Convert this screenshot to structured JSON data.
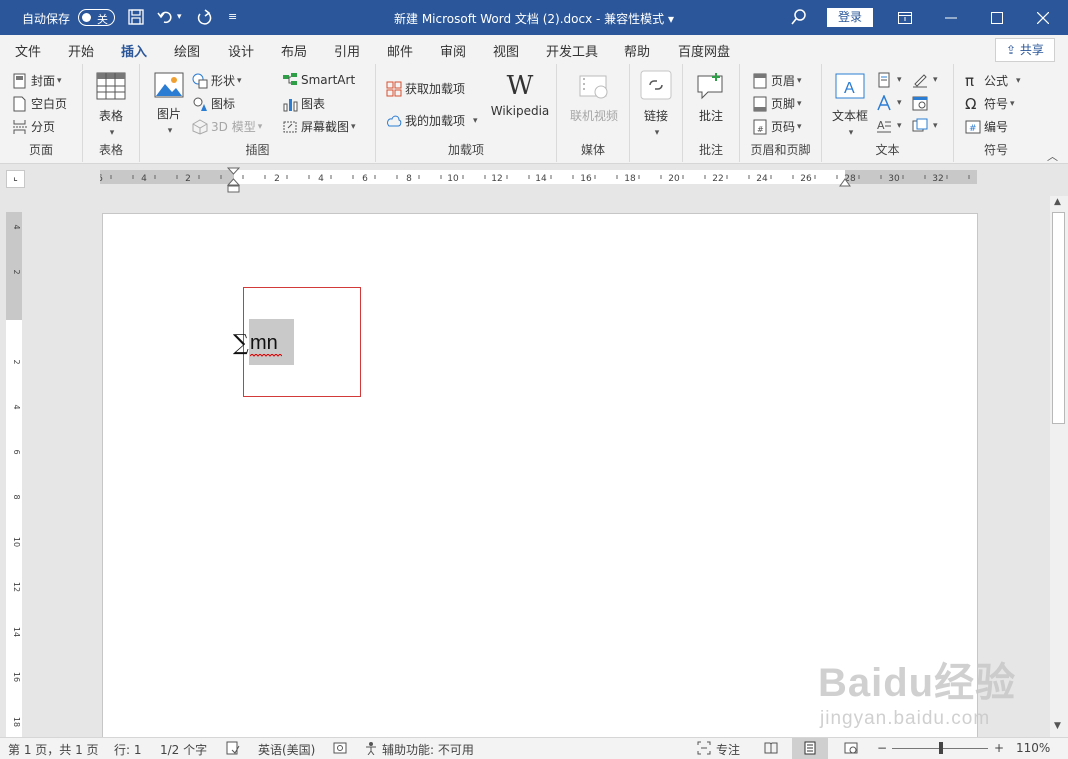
{
  "titlebar": {
    "autosave_label": "自动保存",
    "autosave_state": "关",
    "document_title": "新建 Microsoft Word 文档 (2).docx  -  兼容性模式 ▾",
    "login_label": "登录"
  },
  "tabs": [
    "文件",
    "开始",
    "插入",
    "绘图",
    "设计",
    "布局",
    "引用",
    "邮件",
    "审阅",
    "视图",
    "开发工具",
    "帮助",
    "百度网盘"
  ],
  "active_tab": "插入",
  "share_label": "共享",
  "ribbon": {
    "pages": {
      "label": "页面",
      "cover": "封面",
      "blank": "空白页",
      "break": "分页"
    },
    "table": {
      "label": "表格",
      "table": "表格"
    },
    "illustrations": {
      "label": "插图",
      "picture": "图片",
      "shapes": "形状",
      "icons": "图标",
      "model3d": "3D 模型",
      "smartart": "SmartArt",
      "chart": "图表",
      "screenshot": "屏幕截图"
    },
    "addins": {
      "label": "加载项",
      "get": "获取加载项",
      "mine": "我的加载项",
      "wikipedia": "Wikipedia"
    },
    "media": {
      "label": "媒体",
      "online_video": "联机视频"
    },
    "links": {
      "link": "链接"
    },
    "comments": {
      "label": "批注",
      "comment": "批注"
    },
    "header_footer": {
      "label": "页眉和页脚",
      "header": "页眉",
      "footer": "页脚",
      "page_number": "页码"
    },
    "text": {
      "label": "文本",
      "textbox": "文本框"
    },
    "symbols": {
      "label": "符号",
      "equation": "公式",
      "symbol": "符号",
      "number": "编号"
    }
  },
  "ruler": {
    "h_ticks": [
      "6",
      "4",
      "2",
      "2",
      "4",
      "6",
      "8",
      "10",
      "12",
      "14",
      "16",
      "18",
      "20",
      "22",
      "24",
      "26",
      "28",
      "30",
      "32"
    ],
    "v_ticks": [
      "4",
      "2",
      "2",
      "4",
      "6",
      "8",
      "10",
      "12",
      "14",
      "16",
      "18"
    ]
  },
  "document": {
    "equation_symbol": "∑",
    "equation_text": "mn"
  },
  "statusbar": {
    "page": "第 1 页，共 1 页",
    "line": "行: 1",
    "words": "1/2 个字",
    "language": "英语(美国)",
    "accessibility": "辅助功能: 不可用",
    "focus": "专注",
    "zoom": "110%",
    "zoom_level": 0.5
  },
  "watermark": {
    "line1": "Baidu经验",
    "line2": "jingyan.baidu.com"
  },
  "colors": {
    "brand": "#2b579a",
    "selection": "#c9c9c9",
    "equation_border": "#d23a3a"
  }
}
